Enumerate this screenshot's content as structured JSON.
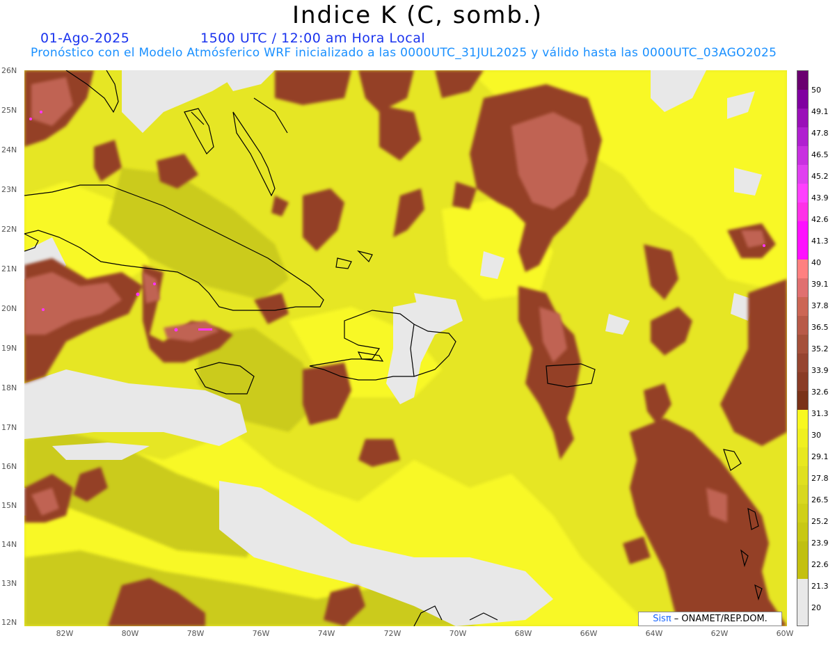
{
  "header": {
    "title": "Indice K (C, somb.)",
    "date": "01-Ago-2025",
    "time": "1500 UTC / 12:00 am Hora Local",
    "description": "Pronóstico con el Modelo Atmósferico WRF inicializado a las 0000UTC_31JUL2025 y válido hasta las  0000UTC_03AGO2025"
  },
  "axes": {
    "lat_labels": [
      "26N",
      "25N",
      "24N",
      "23N",
      "22N",
      "21N",
      "20N",
      "19N",
      "18N",
      "17N",
      "16N",
      "15N",
      "14N",
      "13N",
      "12N"
    ],
    "lon_labels": [
      "82W",
      "80W",
      "78W",
      "76W",
      "74W",
      "72W",
      "70W",
      "68W",
      "66W",
      "64W",
      "62W",
      "60W"
    ]
  },
  "colorbar": {
    "labels": [
      "50",
      "49.1",
      "47.8",
      "46.5",
      "45.2",
      "43.9",
      "42.6",
      "41.3",
      "40",
      "39.1",
      "37.8",
      "36.5",
      "35.2",
      "33.9",
      "32.6",
      "31.3",
      "30",
      "29.1",
      "27.8",
      "26.5",
      "25.2",
      "23.9",
      "22.6",
      "21.3",
      "20"
    ],
    "colors": {
      "below": "#e8e8e8",
      "yellow_dark": "#c8c814",
      "yellow_mid": "#dede1e",
      "yellow_bright": "#f8f828",
      "brown_dark": "#8b3418",
      "brown_mid": "#a5503a",
      "brown_light": "#c8685a",
      "pink": "#ff8080",
      "magenta": "#ff33ff",
      "purple": "#7a0080"
    }
  },
  "credit": {
    "sis": "Sisπ",
    "rest": " – ONAMET/REP.DOM."
  }
}
